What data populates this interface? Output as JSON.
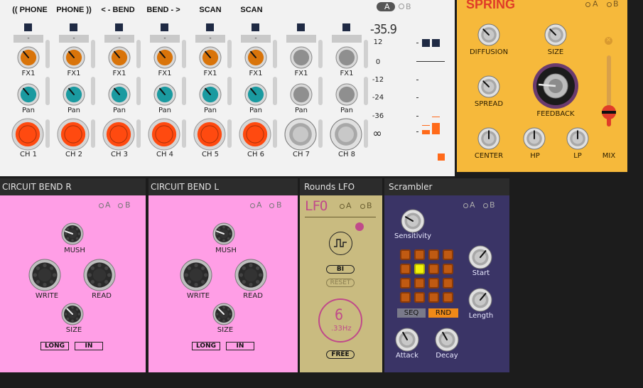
{
  "mixer": {
    "ab": {
      "a": "A",
      "b": "B"
    },
    "headers": [
      "(( PHONE",
      "PHONE ))",
      "< - BEND",
      "BEND - >",
      "SCAN",
      "SCAN"
    ],
    "dash_label": "-",
    "fx_label": "FX1",
    "pan_label": "Pan",
    "channels": [
      "CH 1",
      "CH 2",
      "CH 3",
      "CH 4",
      "CH 5",
      "CH 6",
      "CH 7",
      "CH 8"
    ],
    "level_readout": "-35.9",
    "meter_scale": [
      "12",
      "0",
      "-12",
      "-24",
      "-36",
      "∞"
    ],
    "colors": {
      "fx_knob": "#d9740a",
      "pan_knob": "#1a9aa0",
      "vol_knob": "#ff4a10",
      "inactive_knob": "#8f8f8f"
    }
  },
  "spring": {
    "title": "SPRING",
    "ab": {
      "a": "A",
      "b": "B"
    },
    "labels": {
      "diffusion": "DIFFUSION",
      "size": "SIZE",
      "spread": "SPREAD",
      "feedback": "FEEDBACK",
      "center": "CENTER",
      "hp": "HP",
      "lp": "LP",
      "mix": "MIX"
    },
    "mix_level": 0.2
  },
  "circuit_bend_r": {
    "title": "CIRCUIT BEND R",
    "ab": {
      "a": "A",
      "b": "B"
    },
    "labels": {
      "mush": "MUSH",
      "write": "WRITE",
      "read": "READ",
      "size": "SIZE"
    },
    "buttons": {
      "long": "LONG",
      "in": "IN"
    }
  },
  "circuit_bend_l": {
    "title": "CIRCUIT BEND L",
    "ab": {
      "a": "A",
      "b": "B"
    },
    "labels": {
      "mush": "MUSH",
      "write": "WRITE",
      "read": "READ",
      "size": "SIZE"
    },
    "buttons": {
      "long": "LONG",
      "in": "IN"
    }
  },
  "rounds_lfo": {
    "title": "Rounds LFO",
    "logo": "LFO",
    "ab": {
      "a": "A",
      "b": "B"
    },
    "bi": "BI",
    "reset": "RESET",
    "rate_value": "6",
    "rate_hz": ".33Hz",
    "free": "FREE"
  },
  "scrambler": {
    "title": "Scrambler",
    "ab": {
      "a": "A",
      "b": "B"
    },
    "labels": {
      "sensitivity": "Sensitivity",
      "start": "Start",
      "length": "Length",
      "attack": "Attack",
      "decay": "Decay"
    },
    "seq": "SEQ",
    "rnd": "RND",
    "active_cell": 5
  }
}
